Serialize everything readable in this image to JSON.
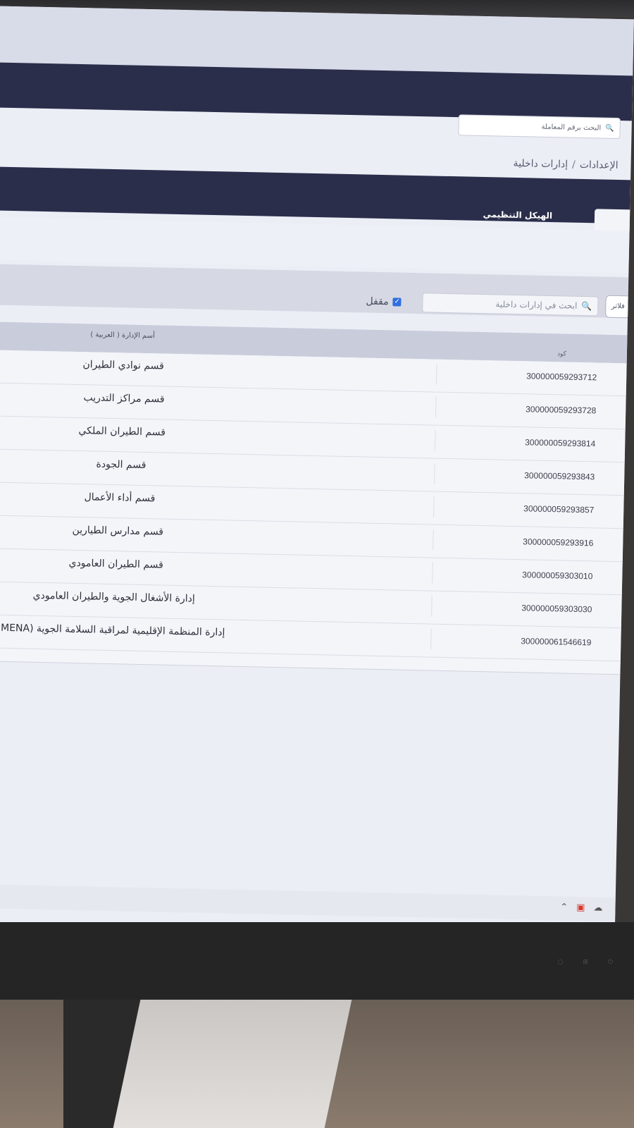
{
  "header": {
    "search_placeholder": "البحث برقم المعاملة",
    "search_icon": "search-icon"
  },
  "breadcrumb": {
    "items": [
      "الإعدادات",
      "إدارات داخلية"
    ],
    "separator": "/"
  },
  "tabs": {
    "org_structure": "الهيكل التنظيمي"
  },
  "filters": {
    "search_placeholder": "ابحث في إدارات داخلية",
    "closed_label": "مقفل",
    "closed_checked": true,
    "filter_button": "فلاتر"
  },
  "table": {
    "columns": {
      "code": "كود",
      "name": "أسم الإدارة ( العربية )"
    },
    "rows": [
      {
        "code": "300000059293712",
        "name": "قسم نوادي الطيران"
      },
      {
        "code": "300000059293728",
        "name": "قسم مراكز التدريب"
      },
      {
        "code": "300000059293814",
        "name": "قسم الطيران الملكي"
      },
      {
        "code": "300000059293843",
        "name": "قسم الجودة"
      },
      {
        "code": "300000059293857",
        "name": "قسم أداء الأعمال"
      },
      {
        "code": "300000059293916",
        "name": "قسم مدارس الطيارين"
      },
      {
        "code": "300000059303010",
        "name": "قسم الطيران العامودي"
      },
      {
        "code": "300000059303030",
        "name": "إدارة الأشغال الجوية والطيران العامودي"
      },
      {
        "code": "300000061546619",
        "name": "إدارة المنظمة الإقليمية لمراقبة السلامة الجوية (MENA)"
      }
    ]
  },
  "colors": {
    "header_bg": "#2b2e4a",
    "checkbox": "#2f6fe0"
  }
}
